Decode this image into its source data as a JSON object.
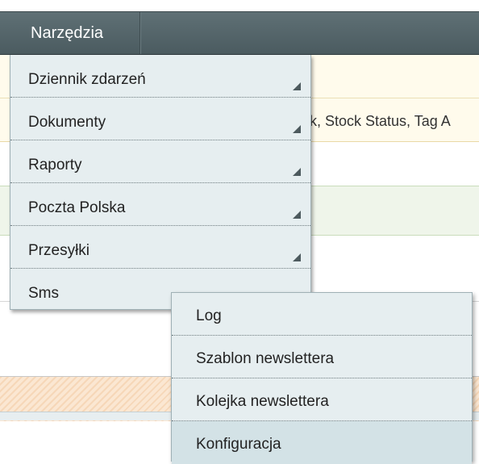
{
  "topbar": {
    "active_tab": "Narzędzia"
  },
  "background": {
    "notice_text": "k, Stock Status, Tag A"
  },
  "menu": {
    "items": [
      {
        "label": "Dziennik zdarzeń",
        "has_submenu": true
      },
      {
        "label": "Dokumenty",
        "has_submenu": true
      },
      {
        "label": "Raporty",
        "has_submenu": true
      },
      {
        "label": "Poczta Polska",
        "has_submenu": true
      },
      {
        "label": "Przesyłki",
        "has_submenu": true
      },
      {
        "label": "Sms",
        "has_submenu": false
      }
    ]
  },
  "submenu": {
    "items": [
      {
        "label": "Log"
      },
      {
        "label": "Szablon newslettera"
      },
      {
        "label": "Kolejka newslettera"
      },
      {
        "label": "Konfiguracja",
        "hovered": true
      }
    ]
  },
  "colors": {
    "topbar": "#55666b",
    "menu_bg": "#e6eef0",
    "menu_hover": "#d3e2e6",
    "notice_bg": "#fffbec",
    "success_bg": "#eff5ea"
  }
}
